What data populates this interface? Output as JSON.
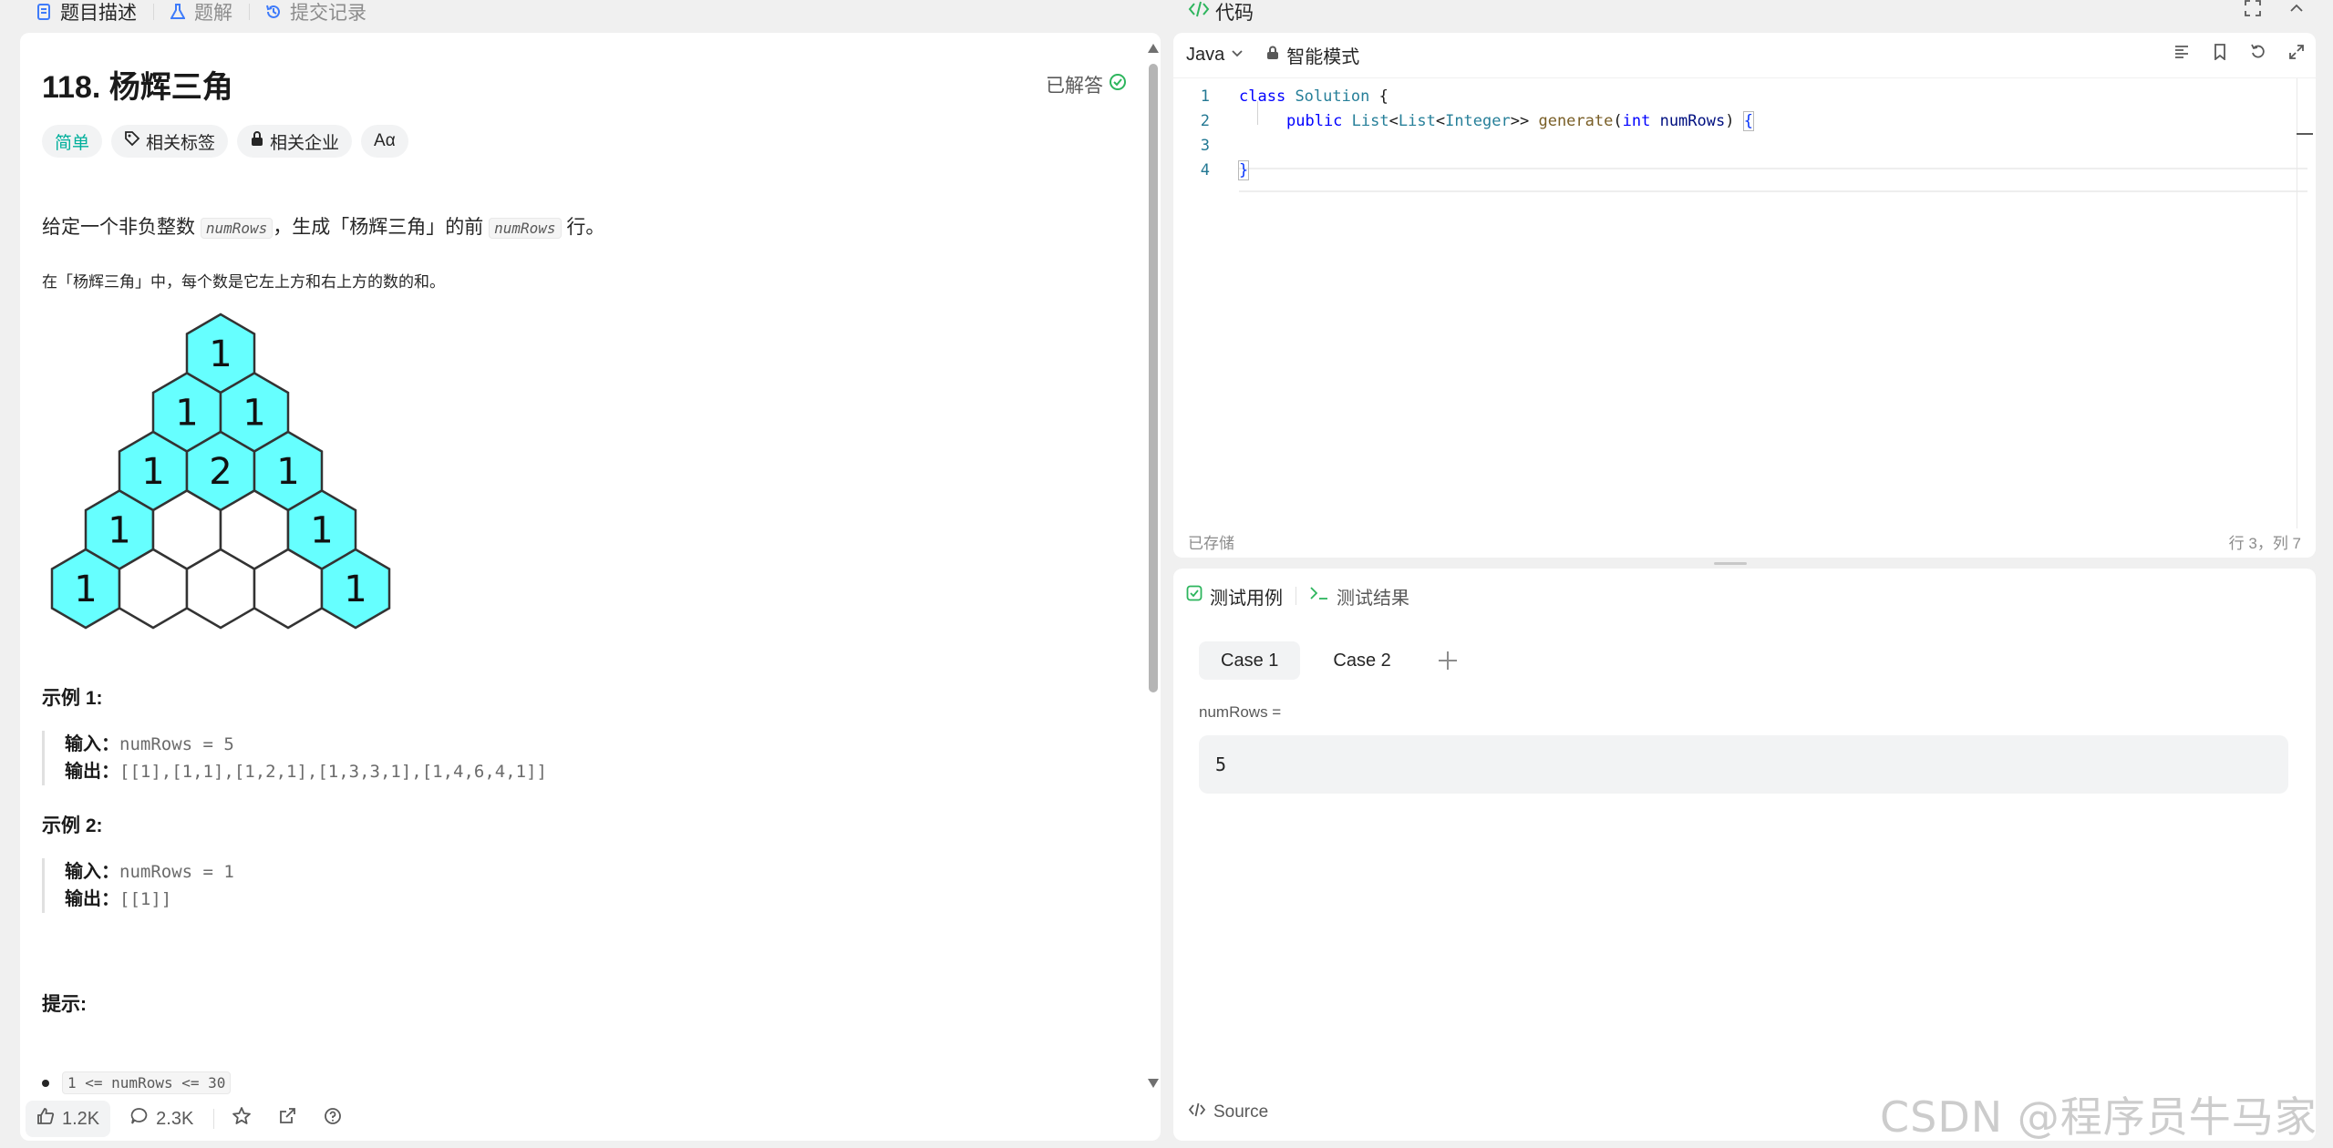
{
  "left_tabs": [
    {
      "label": "题目描述",
      "icon": "document-icon",
      "color": "#3e7bfa"
    },
    {
      "label": "题解",
      "icon": "flask-icon",
      "color": "#3e7bfa"
    },
    {
      "label": "提交记录",
      "icon": "history-icon",
      "color": "#3e7bfa"
    }
  ],
  "problem": {
    "title": "118. 杨辉三角",
    "status": "已解答",
    "tags": {
      "difficulty": "简单",
      "topics": "相关标签",
      "companies": "相关企业",
      "font": "Aα"
    },
    "desc_before": "给定一个非负整数",
    "desc_code1": "numRows",
    "desc_middle": "，生成「杨辉三角」的前",
    "desc_code2": "numRows",
    "desc_after": "行。",
    "desc2": "在「杨辉三角」中，每个数是它左上方和右上方的数的和。",
    "triangle": {
      "rows": [
        [
          "1"
        ],
        [
          "1",
          "1"
        ],
        [
          "1",
          "2",
          "1"
        ],
        [
          "1",
          "",
          "",
          "1"
        ],
        [
          "1",
          "",
          "",
          "",
          "1"
        ]
      ],
      "fill_color": "#66ffff"
    },
    "examples": [
      {
        "title": "示例 1:",
        "input_label": "输入：",
        "input": "numRows = 5",
        "output_label": "输出：",
        "output": "[[1],[1,1],[1,2,1],[1,3,3,1],[1,4,6,4,1]]"
      },
      {
        "title": "示例 2:",
        "input_label": "输入：",
        "input": "numRows = 1",
        "output_label": "输出：",
        "output": "[[1]]"
      }
    ],
    "hint_title": "提示:",
    "constraint": "1 <= numRows <= 30"
  },
  "bottom_bar": {
    "likes": "1.2K",
    "comments": "2.3K"
  },
  "code": {
    "header": "代码",
    "language": "Java",
    "mode": "智能模式",
    "line_numbers": [
      "1",
      "2",
      "3",
      "4"
    ],
    "saved": "已存储",
    "cursor": "行 3，列 7",
    "tokens": {
      "l1_kw": "class",
      "l1_cls": "Solution",
      "l1_brace": "{",
      "l2_kw": "public",
      "l2_type1": "List",
      "l2_lt1": "<",
      "l2_type2": "List",
      "l2_lt2": "<",
      "l2_type3": "Integer",
      "l2_gt": ">>",
      "l2_fn": "generate",
      "l2_paren": "(",
      "l2_int": "int",
      "l2_param": "numRows",
      "l2_close": ")",
      "l2_brace": "{",
      "l4_brace": "}"
    }
  },
  "tests": {
    "tab_cases": "测试用例",
    "tab_results": "测试结果",
    "cases": [
      "Case 1",
      "Case 2"
    ],
    "param_label": "numRows =",
    "param_value": "5",
    "source": "Source"
  },
  "watermark": "CSDN @程序员牛马家",
  "colors": {
    "accent_blue": "#3e7bfa",
    "easy_green": "#00af9b",
    "check_green": "#2db55d"
  }
}
